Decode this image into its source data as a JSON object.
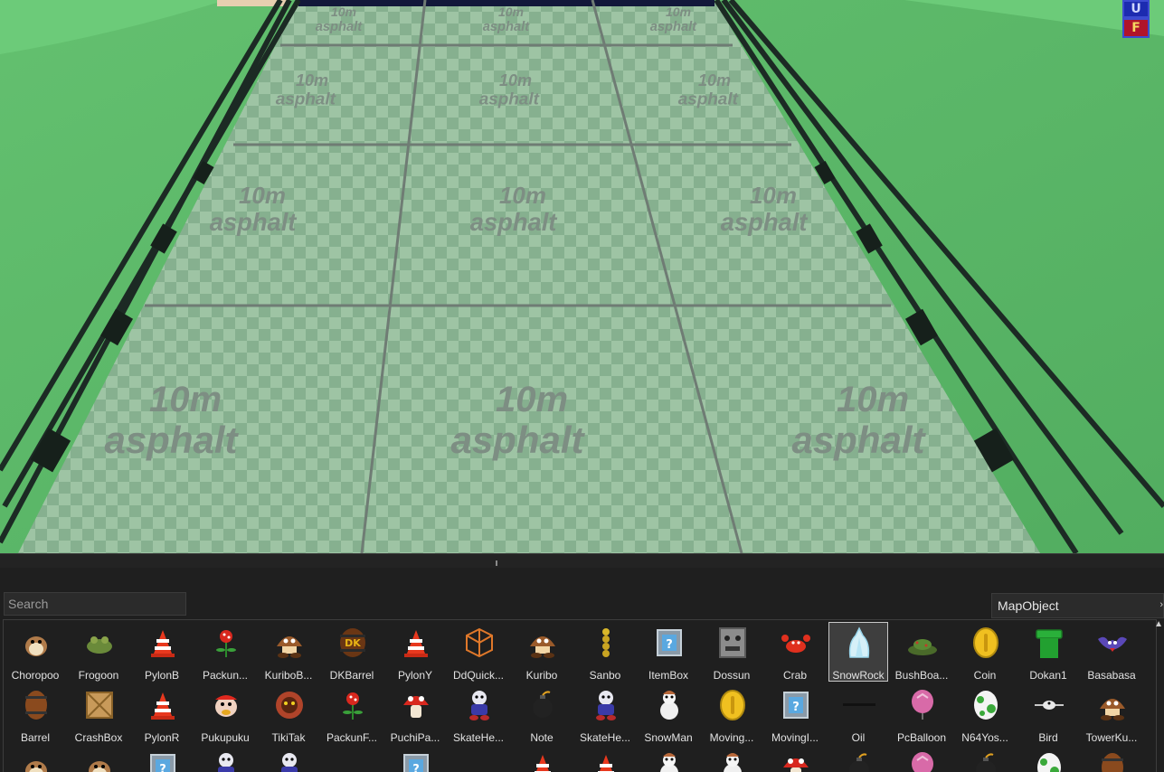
{
  "viewport": {
    "floor_label_line1": "10m",
    "floor_label_line2": "asphalt",
    "colors": {
      "grass": "#5fbf6e",
      "floor_light": "#9ec4a4",
      "floor_dark": "#84ad8c",
      "rail": "#1c2a24"
    },
    "axis_widget": {
      "up_label": "U",
      "front_label": "F"
    }
  },
  "search": {
    "placeholder": "Search",
    "value": ""
  },
  "category": {
    "selected": "MapObject"
  },
  "objects_row1": [
    {
      "label": "Choropoo",
      "icon": "choropoo-icon"
    },
    {
      "label": "Frogoon",
      "icon": "frogoon-icon"
    },
    {
      "label": "PylonB",
      "icon": "pylon-icon"
    },
    {
      "label": "Packun...",
      "icon": "piranha-plant-icon"
    },
    {
      "label": "KuriboB...",
      "icon": "goomba-icon"
    },
    {
      "label": "DKBarrel",
      "icon": "dk-barrel-icon"
    },
    {
      "label": "PylonY",
      "icon": "pylon-icon"
    },
    {
      "label": "DdQuick...",
      "icon": "wireframe-cube-icon"
    },
    {
      "label": "Kuribo",
      "icon": "goomba-icon"
    },
    {
      "label": "Sanbo",
      "icon": "pokey-icon"
    },
    {
      "label": "ItemBox",
      "icon": "item-box-icon"
    },
    {
      "label": "Dossun",
      "icon": "thwomp-icon"
    },
    {
      "label": "Crab",
      "icon": "crab-icon"
    },
    {
      "label": "SnowRock",
      "icon": "snow-rock-icon",
      "selected": true
    },
    {
      "label": "BushBoa...",
      "icon": "bush-icon"
    },
    {
      "label": "Coin",
      "icon": "coin-icon"
    },
    {
      "label": "Dokan1",
      "icon": "pipe-icon"
    },
    {
      "label": "Basabasa",
      "icon": "bat-icon"
    }
  ],
  "objects_row2": [
    {
      "label": "Barrel",
      "icon": "barrel-icon"
    },
    {
      "label": "CrashBox",
      "icon": "crate-icon"
    },
    {
      "label": "PylonR",
      "icon": "pylon-icon"
    },
    {
      "label": "Pukupuku",
      "icon": "cheep-cheep-icon"
    },
    {
      "label": "TikiTak",
      "icon": "tiki-icon"
    },
    {
      "label": "PackunF...",
      "icon": "piranha-plant-icon"
    },
    {
      "label": "PuchiPa...",
      "icon": "mushroom-icon"
    },
    {
      "label": "SkateHe...",
      "icon": "shy-guy-icon"
    },
    {
      "label": "Note",
      "icon": "bomb-icon"
    },
    {
      "label": "SkateHe...",
      "icon": "shy-guy-icon"
    },
    {
      "label": "SnowMan",
      "icon": "snowman-icon"
    },
    {
      "label": "Moving...",
      "icon": "coin-icon"
    },
    {
      "label": "MovingI...",
      "icon": "item-box-icon"
    },
    {
      "label": "Oil",
      "icon": "oil-icon"
    },
    {
      "label": "PcBalloon",
      "icon": "balloon-icon"
    },
    {
      "label": "N64Yos...",
      "icon": "yoshi-egg-icon"
    },
    {
      "label": "Bird",
      "icon": "bird-icon"
    },
    {
      "label": "TowerKu...",
      "icon": "goomba-icon"
    }
  ]
}
